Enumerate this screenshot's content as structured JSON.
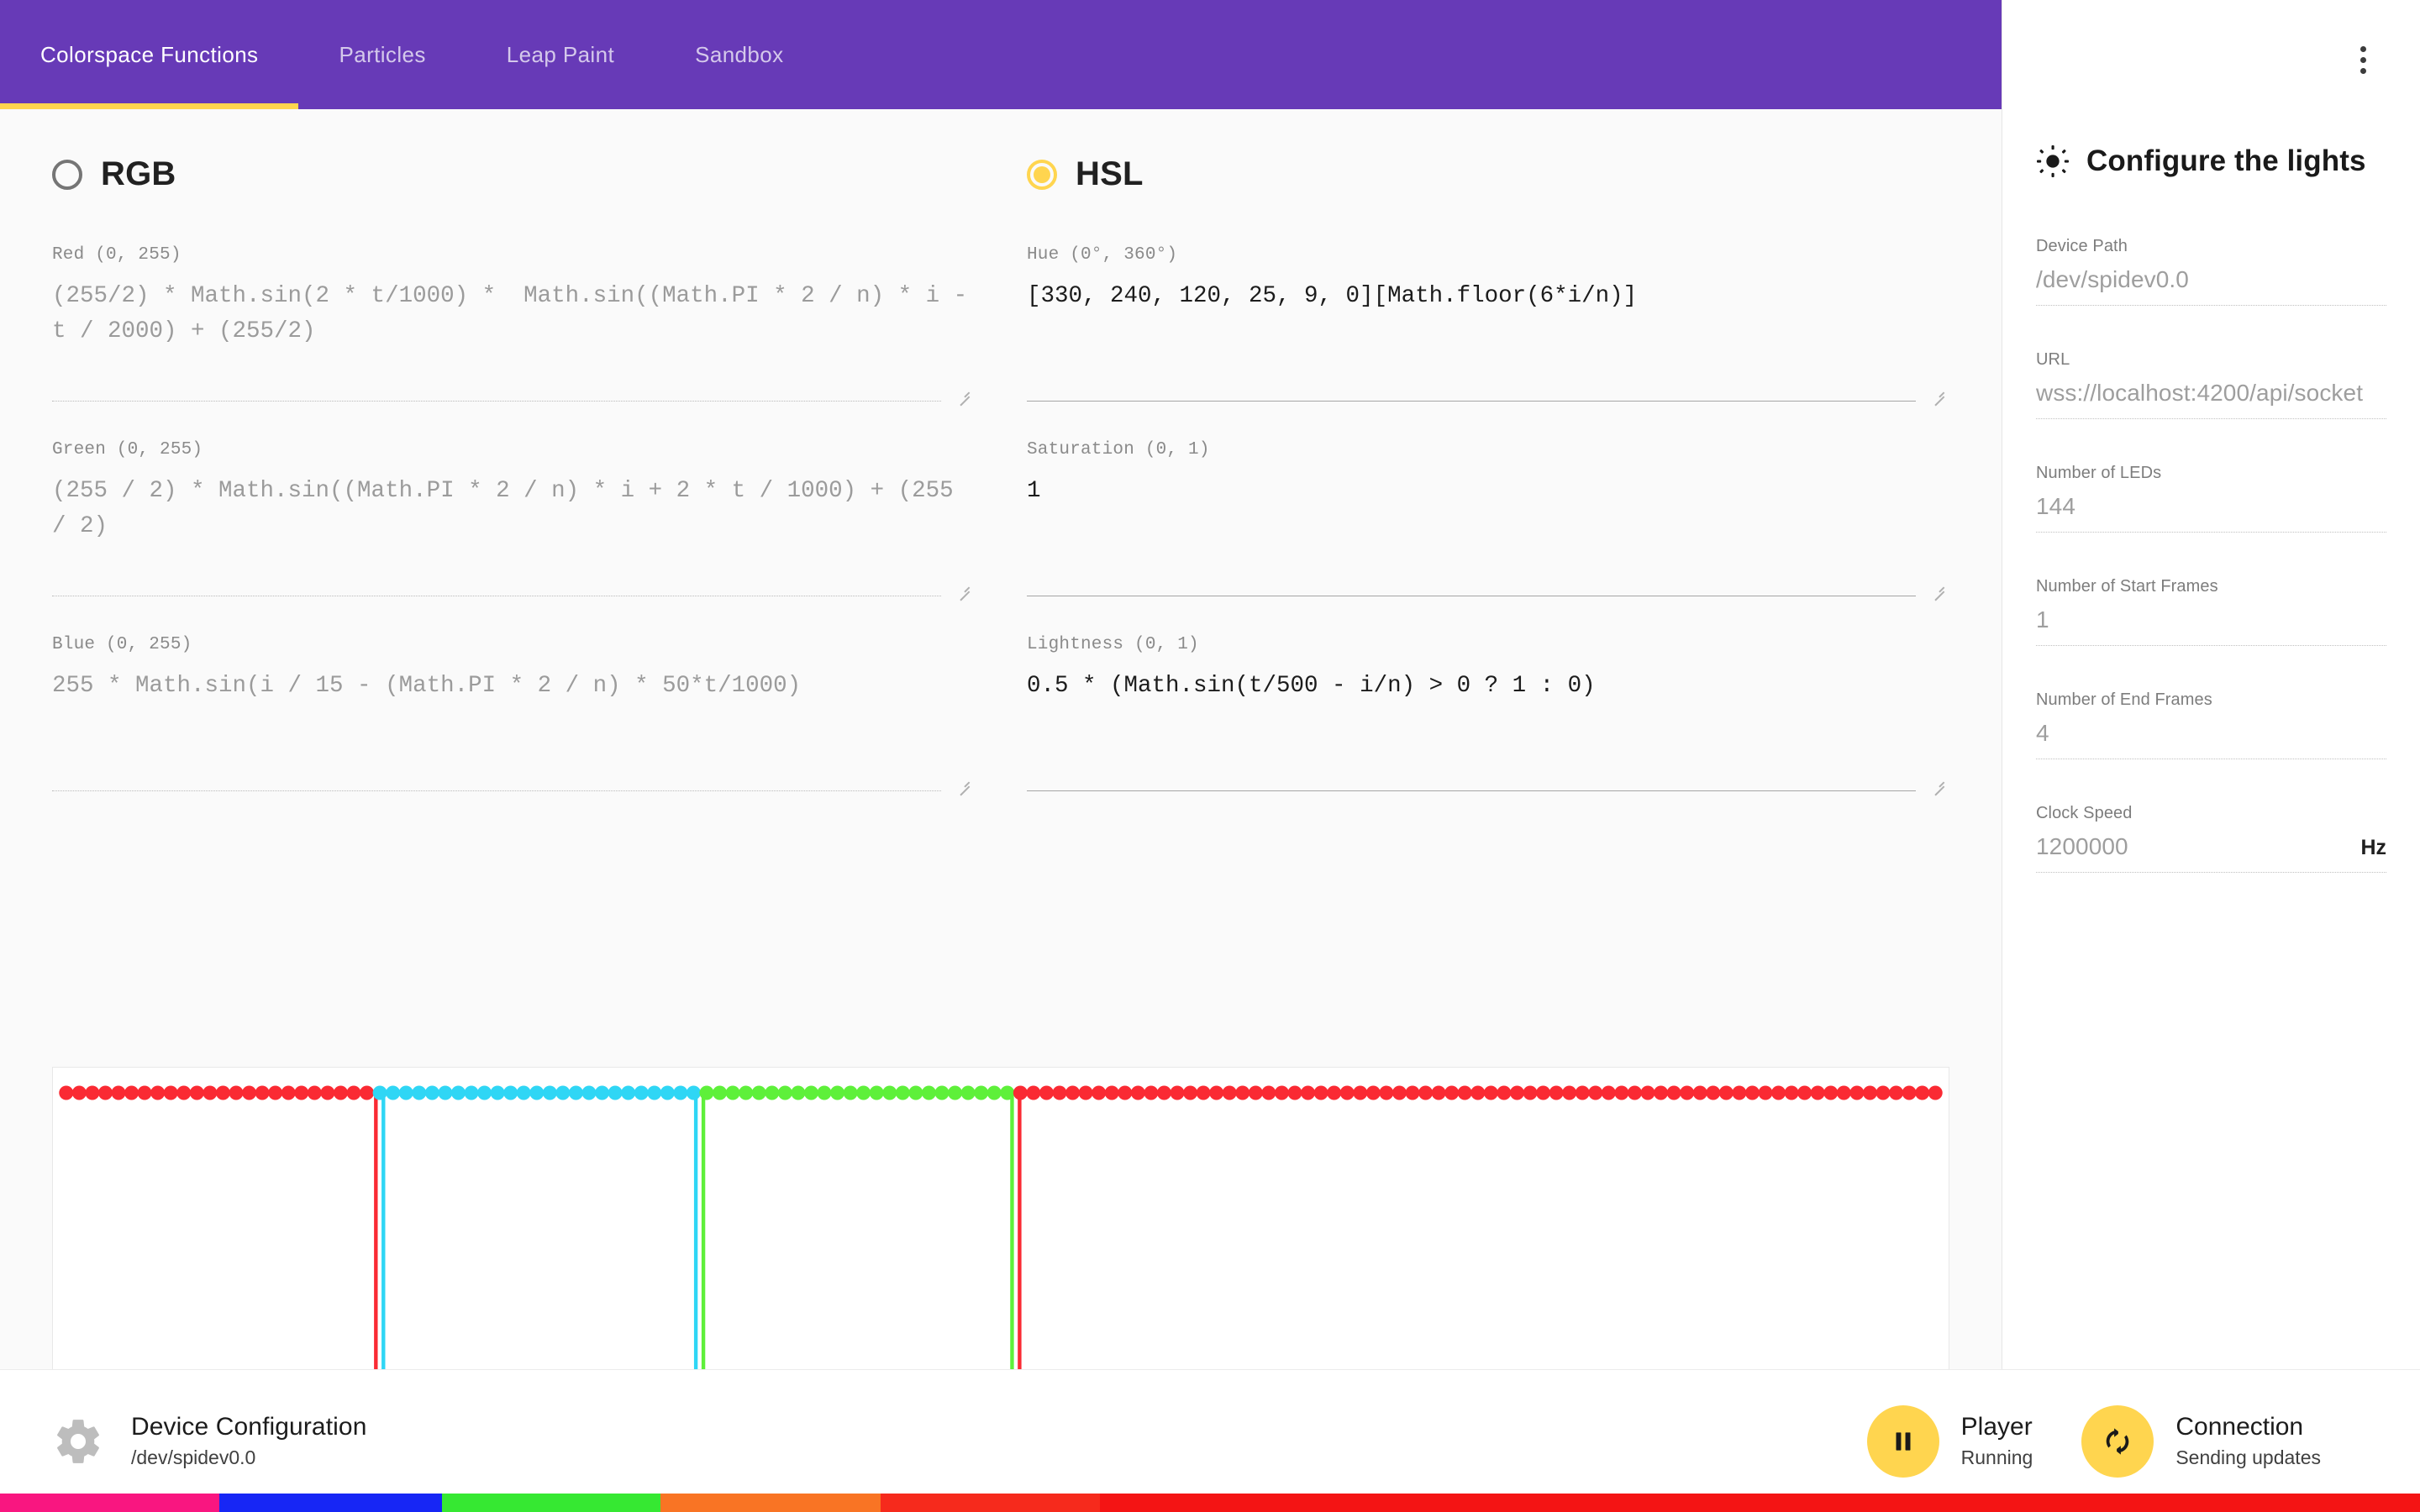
{
  "toolbar": {
    "tabs": [
      {
        "label": "Colorspace Functions",
        "active": true
      },
      {
        "label": "Particles",
        "active": false
      },
      {
        "label": "Leap Paint",
        "active": false
      },
      {
        "label": "Sandbox",
        "active": false
      }
    ],
    "accent": "#673ab7",
    "indicator_color": "#ffd54f",
    "overflow_menu_icon": "kebab-menu-icon"
  },
  "colorspaces": {
    "rgb": {
      "label": "RGB",
      "selected": false,
      "fields": [
        {
          "label": "Red (0, 255)",
          "value": "(255/2) * Math.sin(2 * t/1000) *  Math.sin((Math.PI * 2 / n) * i - t / 2000) + (255/2)"
        },
        {
          "label": "Green (0, 255)",
          "value": "(255 / 2) * Math.sin((Math.PI * 2 / n) * i + 2 * t / 1000) + (255 / 2)"
        },
        {
          "label": "Blue (0, 255)",
          "value": "255 * Math.sin(i / 15 - (Math.PI * 2 / n) * 50*t/1000)"
        }
      ]
    },
    "hsl": {
      "label": "HSL",
      "selected": true,
      "fields": [
        {
          "label": "Hue (0°, 360°)",
          "value": "[330, 240, 120, 25, 9, 0][Math.floor(6*i/n)]"
        },
        {
          "label": "Saturation (0, 1)",
          "value": "1"
        },
        {
          "label": "Lightness (0, 1)",
          "value": "0.5 * (Math.sin(t/500 - i/n) > 0 ? 1 : 0)"
        }
      ]
    }
  },
  "preview": {
    "name": "led-strip-preview",
    "segments": [
      {
        "color": "#fa2a33",
        "start": 0.0,
        "end": 0.168
      },
      {
        "color": "#2fd6f5",
        "start": 0.168,
        "end": 0.338
      },
      {
        "color": "#5ef03a",
        "start": 0.338,
        "end": 0.506
      },
      {
        "color": "#fa2a33",
        "start": 0.506,
        "end": 1.0
      }
    ],
    "dot_count": 144,
    "drop_lines": [
      {
        "color": "#fa2a33",
        "x": 0.168
      },
      {
        "color": "#2fd6f5",
        "x": 0.172
      },
      {
        "color": "#2fd6f5",
        "x": 0.338
      },
      {
        "color": "#5ef03a",
        "x": 0.342
      },
      {
        "color": "#5ef03a",
        "x": 0.506
      },
      {
        "color": "#fa2a33",
        "x": 0.51
      }
    ]
  },
  "sidebar": {
    "title": "Configure the lights",
    "icon": "sun-brightness-icon",
    "fields": [
      {
        "label": "Device Path",
        "value": "/dev/spidev0.0",
        "suffix": ""
      },
      {
        "label": "URL",
        "value": "wss://localhost:4200/api/socket",
        "suffix": ""
      },
      {
        "label": "Number of LEDs",
        "value": "144",
        "suffix": ""
      },
      {
        "label": "Number of Start Frames",
        "value": "1",
        "suffix": ""
      },
      {
        "label": "Number of End Frames",
        "value": "4",
        "suffix": ""
      },
      {
        "label": "Clock Speed",
        "value": "1200000",
        "suffix": "Hz"
      }
    ]
  },
  "bottom_bar": {
    "device": {
      "icon": "gear-icon",
      "title": "Device Configuration",
      "subtitle": "/dev/spidev0.0"
    },
    "player": {
      "icon": "pause-icon",
      "title": "Player",
      "subtitle": "Running",
      "fab_color": "#ffd54f"
    },
    "connection": {
      "icon": "sync-icon",
      "title": "Connection",
      "subtitle": "Sending updates",
      "fab_color": "#ffd54f"
    }
  },
  "color_strip": {
    "name": "led-output-color-strip",
    "bands": [
      {
        "color": "#f91680",
        "width": 0.0905
      },
      {
        "color": "#1726f5",
        "width": 0.092
      },
      {
        "color": "#36e832",
        "width": 0.0905
      },
      {
        "color": "#f97424",
        "width": 0.091
      },
      {
        "color": "#f62a1c",
        "width": 0.0905
      },
      {
        "color": "#f41414",
        "width": 0.5455
      }
    ]
  }
}
